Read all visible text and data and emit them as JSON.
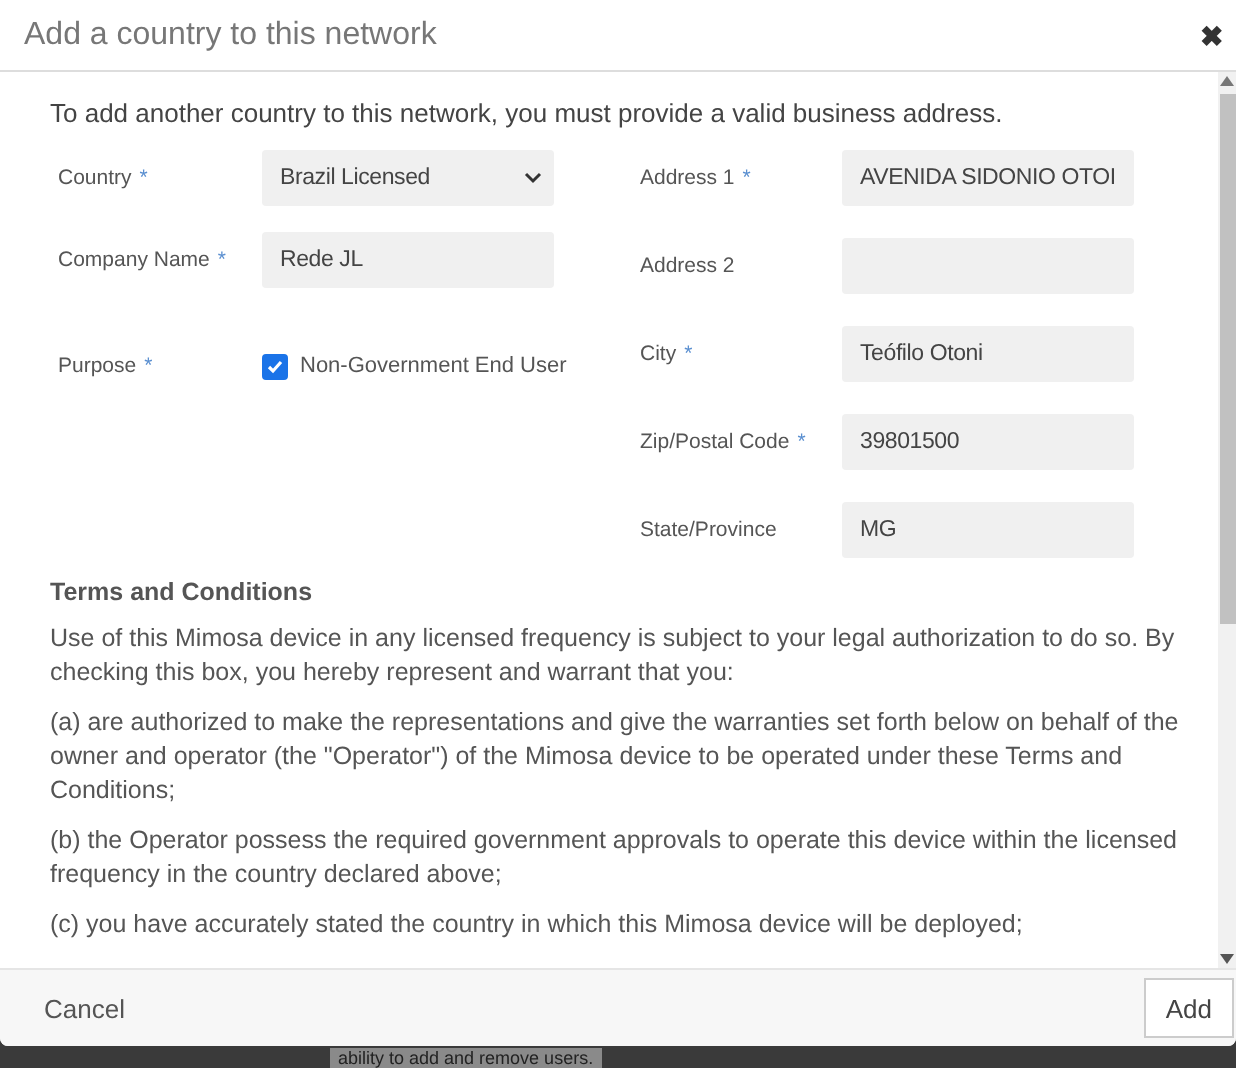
{
  "dialog": {
    "title": "Add a country to this network",
    "close_glyph": "✖"
  },
  "intro": "To add another country to this network, you must provide a valid business address.",
  "left_fields": [
    {
      "kind": "select",
      "label": "Country",
      "required_mark": "*",
      "value": "Brazil Licensed"
    },
    {
      "kind": "text",
      "label": "Company Name",
      "required_mark": "*",
      "value": "Rede JL"
    },
    {
      "kind": "checkbox",
      "label": "Purpose",
      "required_mark": "*",
      "option": "Non-Government End User",
      "checked": true
    }
  ],
  "right_fields": [
    {
      "kind": "text",
      "label": "Address 1",
      "required_mark": "*",
      "value": "AVENIDA SIDONIO OTOI"
    },
    {
      "kind": "text",
      "label": "Address 2"
    },
    {
      "kind": "text",
      "label": "City",
      "required_mark": "*",
      "value": "Teófilo Otoni"
    },
    {
      "kind": "text",
      "label": "Zip/Postal Code",
      "required_mark": "*",
      "value": "39801500"
    },
    {
      "kind": "text",
      "label": "State/Province",
      "value": "MG"
    }
  ],
  "terms": {
    "heading": "Terms and Conditions",
    "paragraphs": [
      "Use of this Mimosa device in any licensed frequency is subject to your legal authorization to do so. By checking this box, you hereby represent and warrant that you:",
      "(a) are authorized to make the representations and give the warranties set forth below on behalf of the owner and operator (the \"Operator\") of the Mimosa device to be operated under these Terms and Conditions;",
      "(b) the Operator possess the required government approvals to operate this device within the licensed frequency in the country declared above;",
      "(c) you have accurately stated the country in which this Mimosa device will be deployed;"
    ]
  },
  "footer": {
    "cancel": "Cancel",
    "add": "Add"
  },
  "backdrop_text": "ability to add and remove users."
}
